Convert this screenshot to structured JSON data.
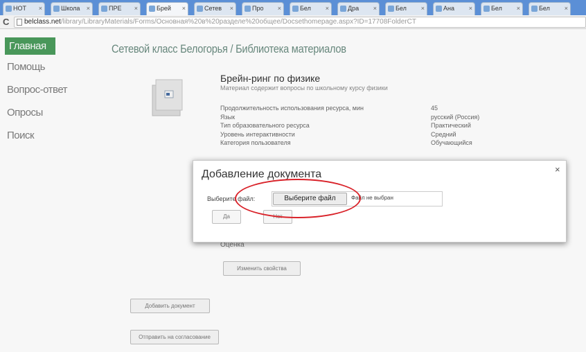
{
  "browser": {
    "tabs": [
      "HOT",
      "Школа",
      "ПРЕ",
      "Брей",
      "Сетев",
      "Про",
      "Бел",
      "Дра",
      "Бел",
      "Ана",
      "Бел",
      "Бел"
    ],
    "active_tab": 3,
    "url_host": "belclass.net",
    "url_path": "/library/LibraryMaterials/Forms/Основная%20в%20разделе%20общее/Docsethomepage.aspx?ID=17708FolderCT"
  },
  "sidebar": {
    "items": [
      {
        "label": "Главная",
        "active": true
      },
      {
        "label": "Помощь",
        "active": false
      },
      {
        "label": "Вопрос-ответ",
        "active": false
      },
      {
        "label": "Опросы",
        "active": false
      },
      {
        "label": "Поиск",
        "active": false
      }
    ]
  },
  "page": {
    "title": "Сетевой класс Белогорья / Библиотека материалов",
    "resource_title": "Брейн-ринг по физике",
    "resource_desc": "Материал содержит вопросы по школьному курсу физики",
    "properties": [
      {
        "label": "Продолжительность использования ресурса, мин",
        "value": "45"
      },
      {
        "label": "Язык",
        "value": "русский (Россия)"
      },
      {
        "label": "Тип образовательного ресурса",
        "value": "Практический"
      },
      {
        "label": "Уровень интерактивности",
        "value": "Средний"
      },
      {
        "label": "Категория пользователя",
        "value": "Обучающийся"
      }
    ],
    "rating_label": "Оценка",
    "edit_props_button": "Изменить свойства",
    "add_document_button": "Добавить документ",
    "send_for_approval_button": "Отправить на согласование"
  },
  "dialog": {
    "title": "Добавление документа",
    "close": "×",
    "file_label": "Выберите файл:",
    "choose_button": "Выберите файл",
    "file_status": "Файл не выбран",
    "ok_button": "Да",
    "cancel_button": "Нет"
  },
  "colors": {
    "accent_green": "#4c9c5d",
    "highlight_red": "#d9232a"
  }
}
